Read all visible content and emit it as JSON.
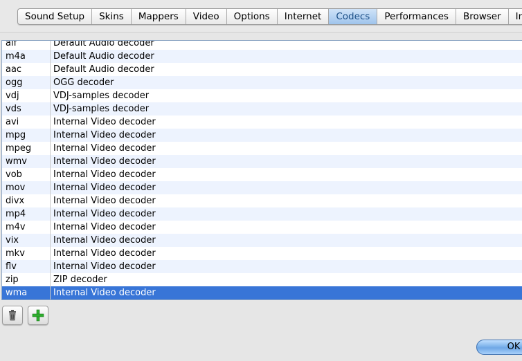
{
  "tabs": [
    {
      "label": "Sound Setup",
      "active": false
    },
    {
      "label": "Skins",
      "active": false
    },
    {
      "label": "Mappers",
      "active": false
    },
    {
      "label": "Video",
      "active": false
    },
    {
      "label": "Options",
      "active": false
    },
    {
      "label": "Internet",
      "active": false
    },
    {
      "label": "Codecs",
      "active": true
    },
    {
      "label": "Performances",
      "active": false
    },
    {
      "label": "Browser",
      "active": false
    },
    {
      "label": "Info",
      "active": false
    }
  ],
  "codecs": [
    {
      "ext": "aif",
      "decoder": "Default Audio decoder"
    },
    {
      "ext": "m4a",
      "decoder": "Default Audio decoder"
    },
    {
      "ext": "aac",
      "decoder": "Default Audio decoder"
    },
    {
      "ext": "ogg",
      "decoder": "OGG decoder"
    },
    {
      "ext": "vdj",
      "decoder": "VDJ-samples decoder"
    },
    {
      "ext": "vds",
      "decoder": "VDJ-samples decoder"
    },
    {
      "ext": "avi",
      "decoder": "Internal Video decoder"
    },
    {
      "ext": "mpg",
      "decoder": "Internal Video decoder"
    },
    {
      "ext": "mpeg",
      "decoder": "Internal Video decoder"
    },
    {
      "ext": "wmv",
      "decoder": "Internal Video decoder"
    },
    {
      "ext": "vob",
      "decoder": "Internal Video decoder"
    },
    {
      "ext": "mov",
      "decoder": "Internal Video decoder"
    },
    {
      "ext": "divx",
      "decoder": "Internal Video decoder"
    },
    {
      "ext": "mp4",
      "decoder": "Internal Video decoder"
    },
    {
      "ext": "m4v",
      "decoder": "Internal Video decoder"
    },
    {
      "ext": "vix",
      "decoder": "Internal Video decoder"
    },
    {
      "ext": "mkv",
      "decoder": "Internal Video decoder"
    },
    {
      "ext": "flv",
      "decoder": "Internal Video decoder"
    },
    {
      "ext": "zip",
      "decoder": "ZIP decoder"
    },
    {
      "ext": "wma",
      "decoder": "Internal Video decoder",
      "selected": true
    }
  ],
  "icons": {
    "delete": "trash-icon",
    "add": "plus-icon"
  },
  "colors": {
    "selection": "#3875d7",
    "active_tab": "#9fc4ec",
    "add_icon": "#2fae2f"
  },
  "ok_label": "OK"
}
